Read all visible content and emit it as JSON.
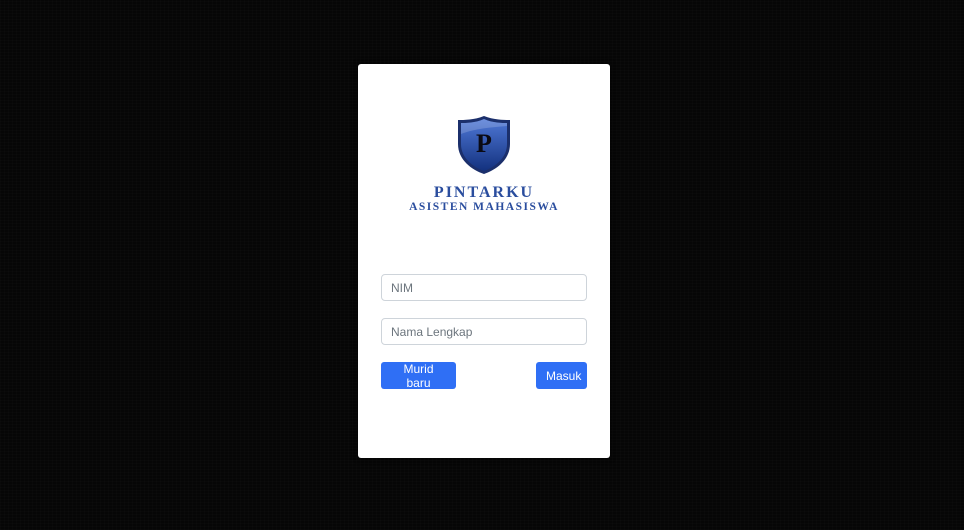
{
  "logo": {
    "letter": "P",
    "brand": "PINTARKU",
    "tagline": "ASISTEN MAHASISWA"
  },
  "form": {
    "nim_placeholder": "NIM",
    "name_placeholder": "Nama Lengkap",
    "new_student_label": "Murid baru",
    "login_label": "Masuk"
  },
  "colors": {
    "background": "#060606",
    "card": "#ffffff",
    "brand_blue": "#2a4d9e",
    "button_blue": "#2f6ff5"
  }
}
